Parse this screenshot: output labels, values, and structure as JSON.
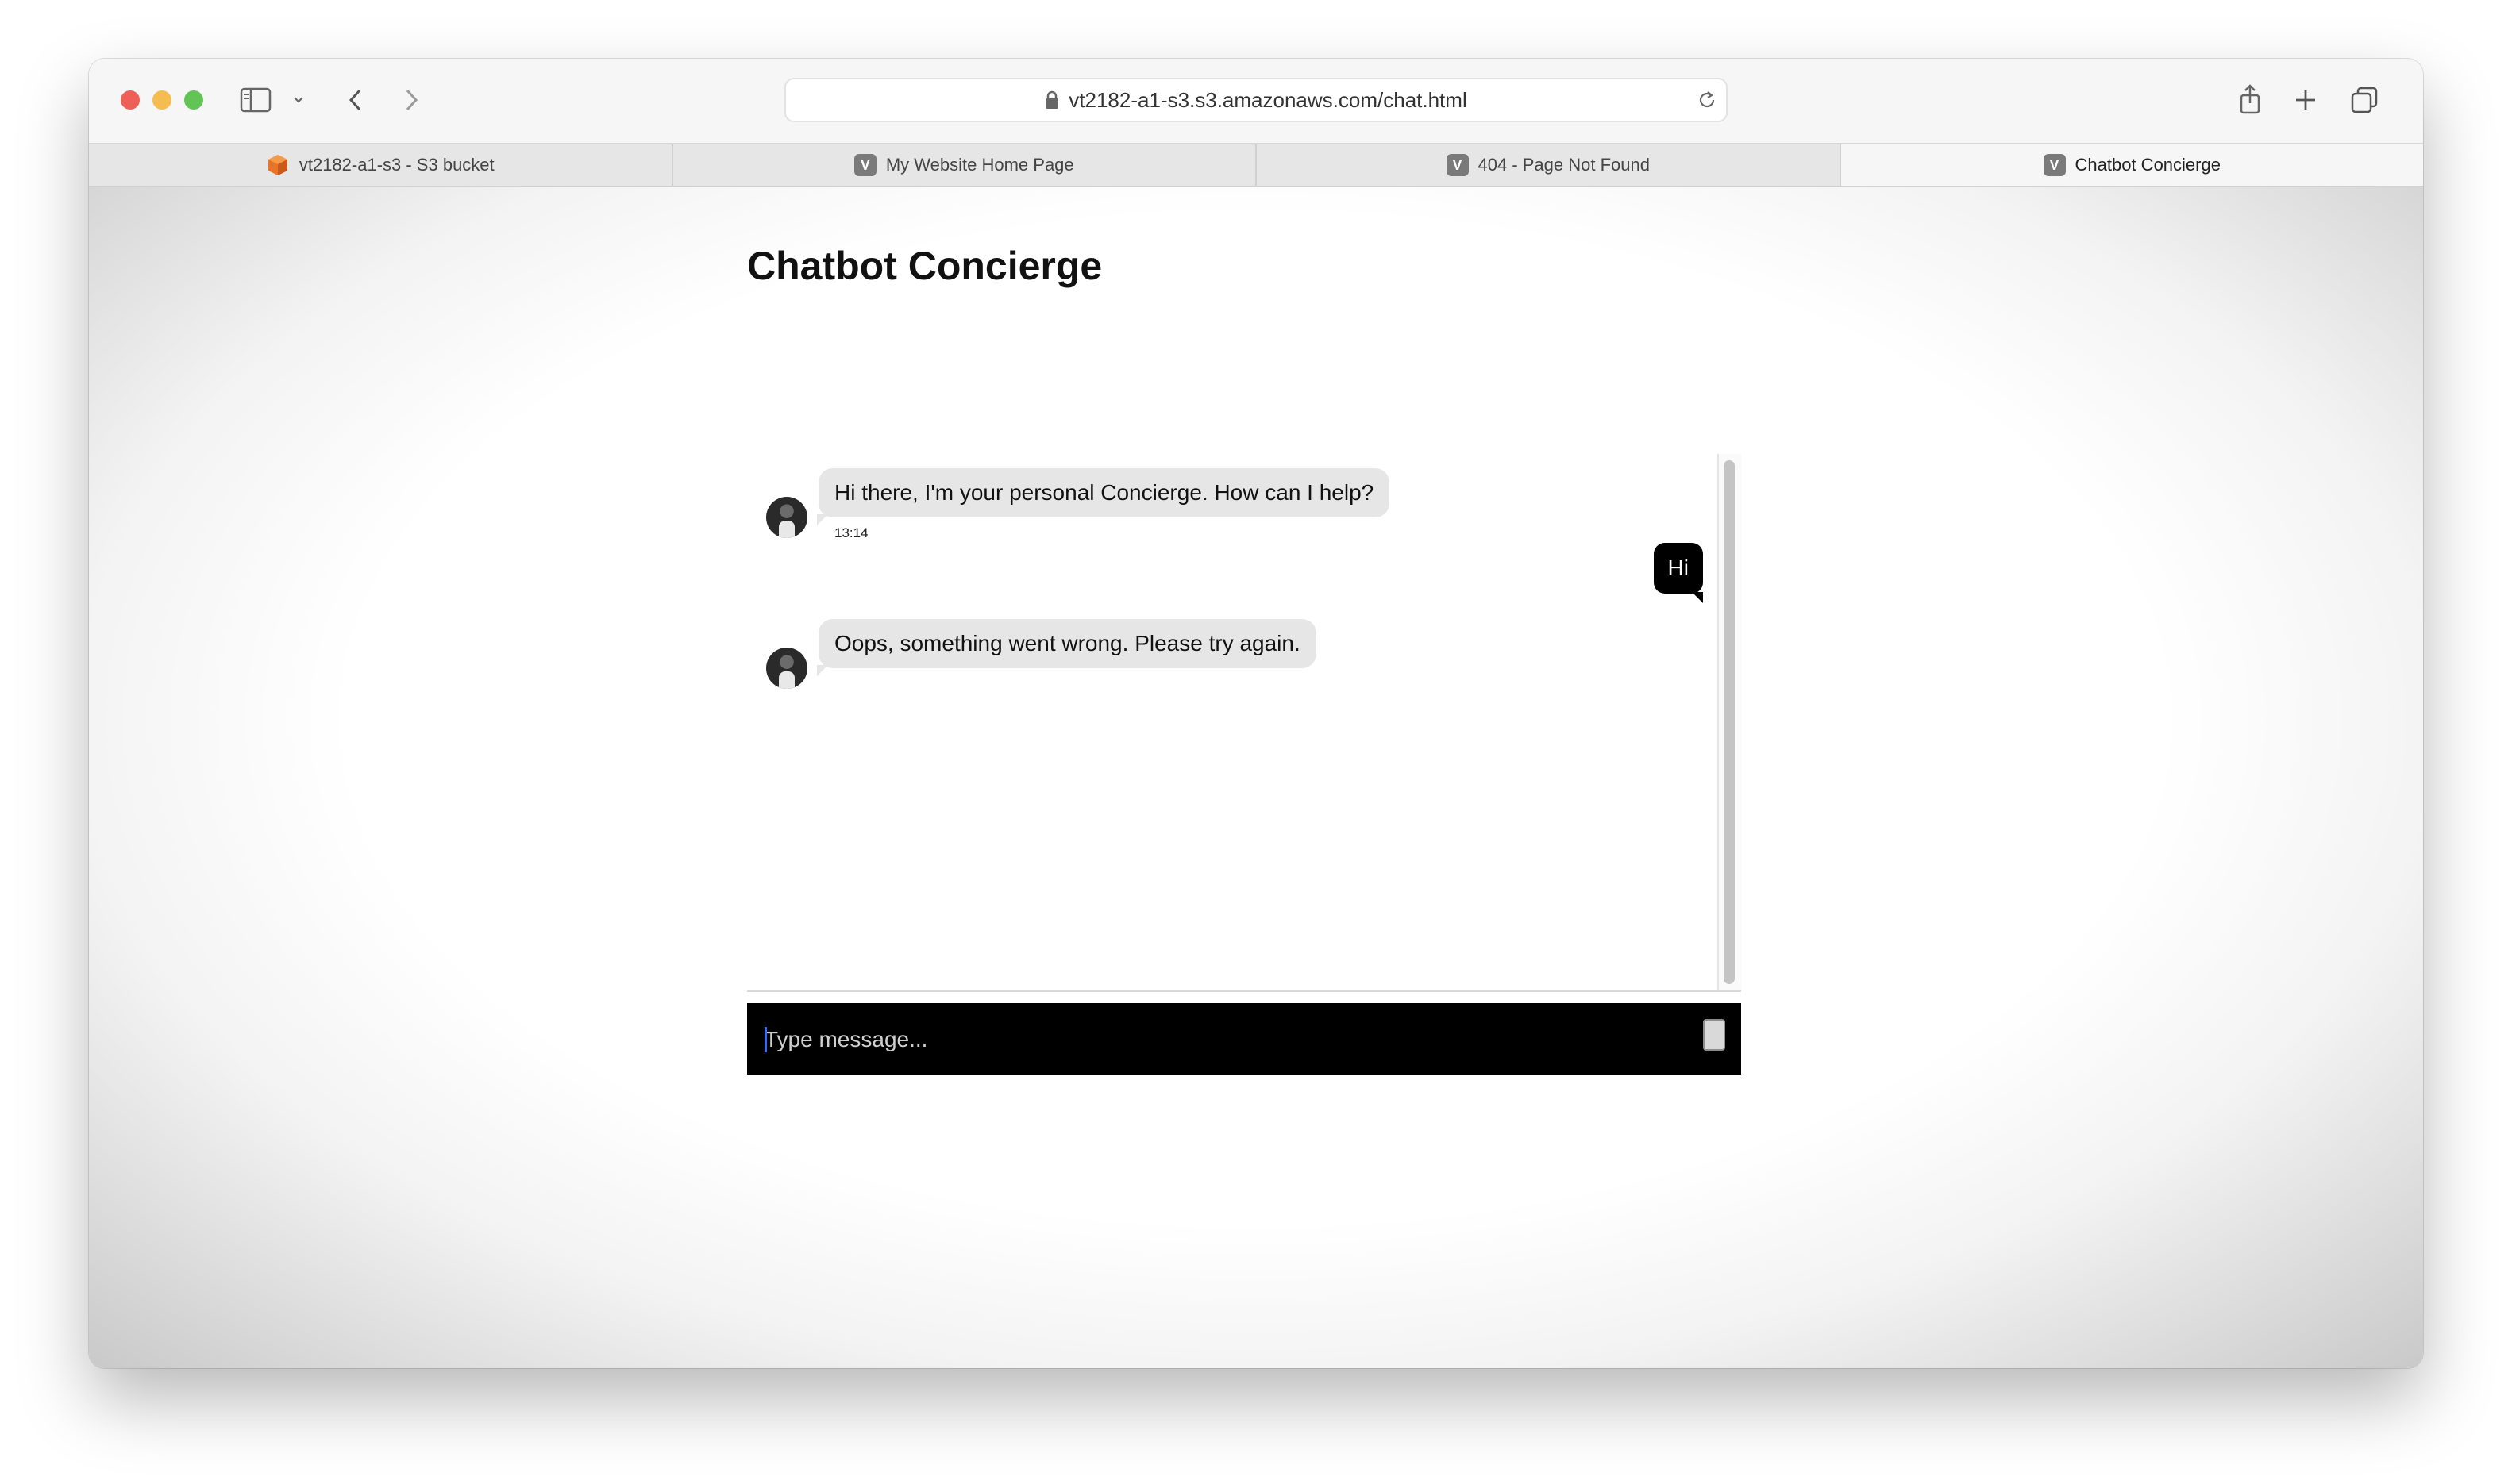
{
  "browser": {
    "url": "vt2182-a1-s3.s3.amazonaws.com/chat.html",
    "tabs": [
      {
        "label": "vt2182-a1-s3 - S3 bucket",
        "favicon": "s3-bucket-icon",
        "active": false
      },
      {
        "label": "My Website Home Page",
        "favicon": "V",
        "active": false
      },
      {
        "label": "404 - Page Not Found",
        "favicon": "V",
        "active": false
      },
      {
        "label": "Chatbot Concierge",
        "favicon": "V",
        "active": true
      }
    ]
  },
  "page": {
    "title": "Chatbot Concierge"
  },
  "chat": {
    "messages": [
      {
        "sender": "bot",
        "text": "Hi there, I'm your personal Concierge. How can I help?",
        "time": "13:14"
      },
      {
        "sender": "user",
        "text": "Hi"
      },
      {
        "sender": "bot",
        "text": "Oops, something went wrong. Please try again."
      }
    ],
    "input_placeholder": "Type message..."
  },
  "colors": {
    "user_bubble": "#000000",
    "bot_bubble": "#e6e6e6",
    "input_bar": "#000000"
  }
}
